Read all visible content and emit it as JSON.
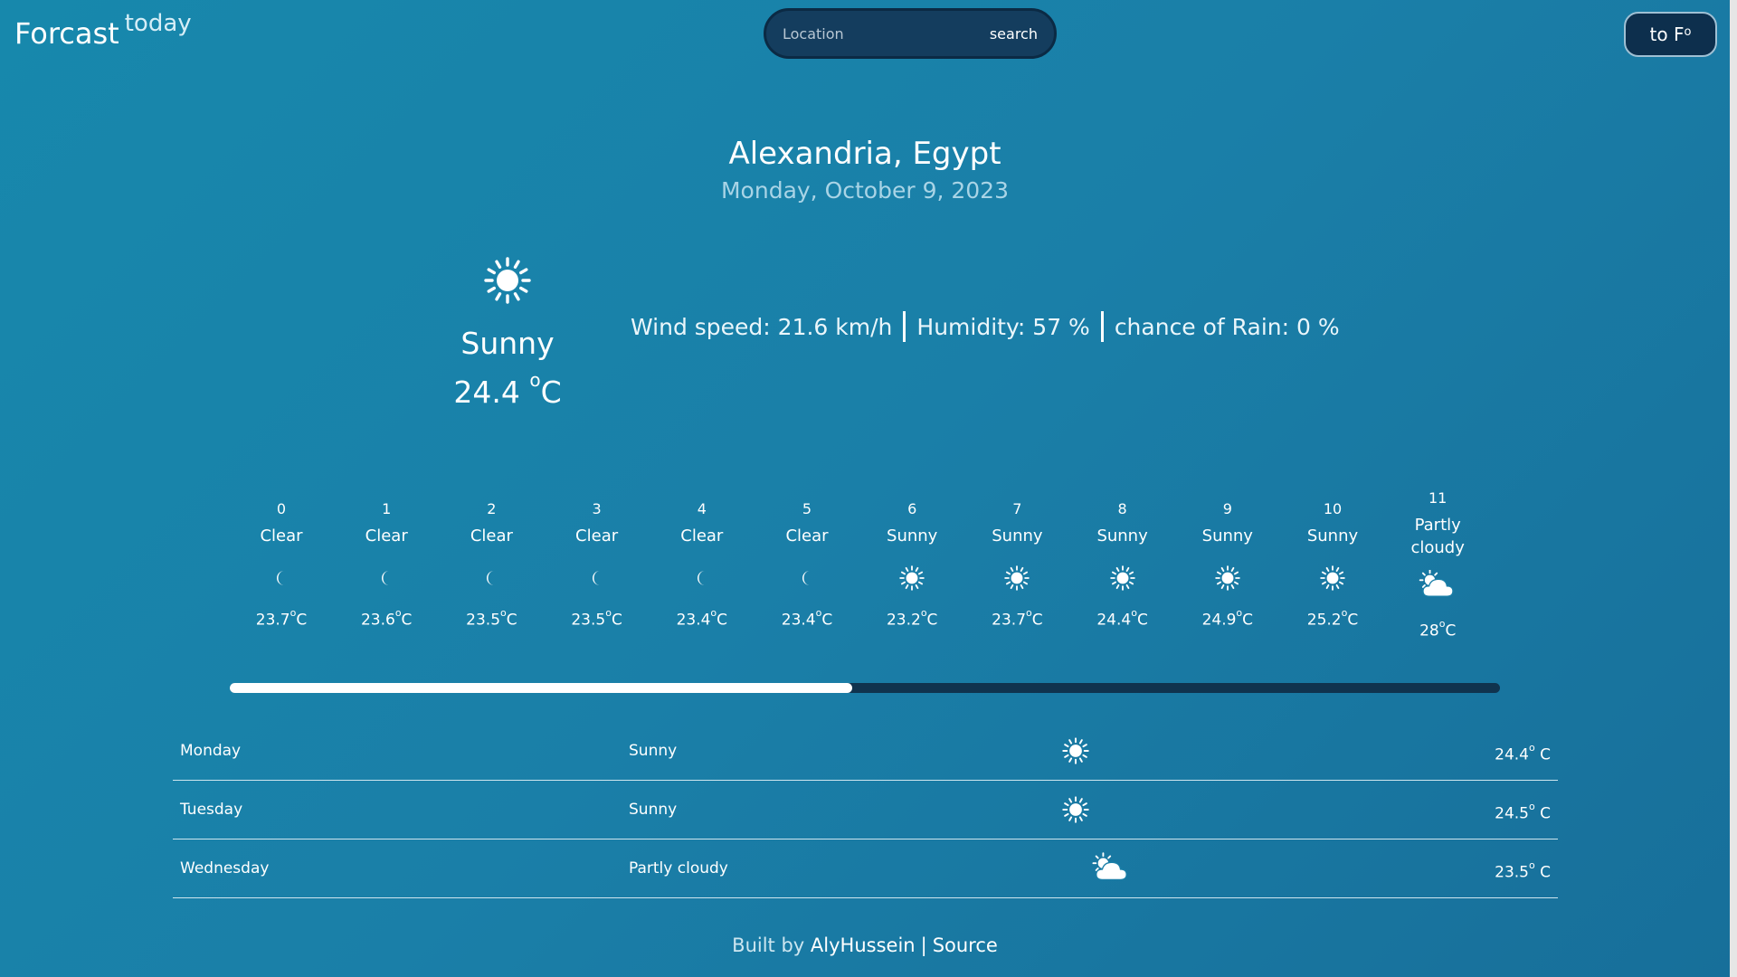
{
  "header": {
    "brand_main": "Forcast",
    "brand_sub": "today",
    "search_placeholder": "Location",
    "search_button": "search",
    "unit_toggle_label": "to F",
    "unit_toggle_degree": "o"
  },
  "location": {
    "name": "Alexandria, Egypt",
    "date": "Monday, October 9, 2023"
  },
  "current": {
    "condition": "Sunny",
    "temp_value": "24.4",
    "temp_degree": "o",
    "temp_unit": "C",
    "icon": "sun-icon",
    "wind": "Wind speed: 21.6 km/h",
    "humidity": "Humidity: 57 %",
    "rain": "chance of Rain: 0 %"
  },
  "hourly": [
    {
      "hour": "0",
      "condition": "Clear",
      "icon": "moon",
      "temp": "23.7",
      "unit": "C"
    },
    {
      "hour": "1",
      "condition": "Clear",
      "icon": "moon",
      "temp": "23.6",
      "unit": "C"
    },
    {
      "hour": "2",
      "condition": "Clear",
      "icon": "moon",
      "temp": "23.5",
      "unit": "C"
    },
    {
      "hour": "3",
      "condition": "Clear",
      "icon": "moon",
      "temp": "23.5",
      "unit": "C"
    },
    {
      "hour": "4",
      "condition": "Clear",
      "icon": "moon",
      "temp": "23.4",
      "unit": "C"
    },
    {
      "hour": "5",
      "condition": "Clear",
      "icon": "moon",
      "temp": "23.4",
      "unit": "C"
    },
    {
      "hour": "6",
      "condition": "Sunny",
      "icon": "sun",
      "temp": "23.2",
      "unit": "C"
    },
    {
      "hour": "7",
      "condition": "Sunny",
      "icon": "sun",
      "temp": "23.7",
      "unit": "C"
    },
    {
      "hour": "8",
      "condition": "Sunny",
      "icon": "sun",
      "temp": "24.4",
      "unit": "C"
    },
    {
      "hour": "9",
      "condition": "Sunny",
      "icon": "sun",
      "temp": "24.9",
      "unit": "C"
    },
    {
      "hour": "10",
      "condition": "Sunny",
      "icon": "sun",
      "temp": "25.2",
      "unit": "C"
    },
    {
      "hour": "11",
      "condition": "Partly cloudy",
      "icon": "cloud",
      "temp": "28",
      "unit": "C"
    }
  ],
  "hourly_scroll_fraction": 0.49,
  "daily": [
    {
      "day": "Monday",
      "condition": "Sunny",
      "icon": "sun",
      "temp": "24.4",
      "unit": " C"
    },
    {
      "day": "Tuesday",
      "condition": "Sunny",
      "icon": "sun",
      "temp": "24.5",
      "unit": " C"
    },
    {
      "day": "Wednesday",
      "condition": "Partly cloudy",
      "icon": "cloud",
      "temp": "23.5",
      "unit": " C"
    }
  ],
  "footer": {
    "built_by": "Built by",
    "author": "AlyHussein",
    "separator": "|",
    "source": "Source"
  },
  "colors": {
    "background": "#1a7fa8",
    "search_bg": "#143d5e",
    "track": "#10334e",
    "accent_text": "#a9d4e6"
  }
}
